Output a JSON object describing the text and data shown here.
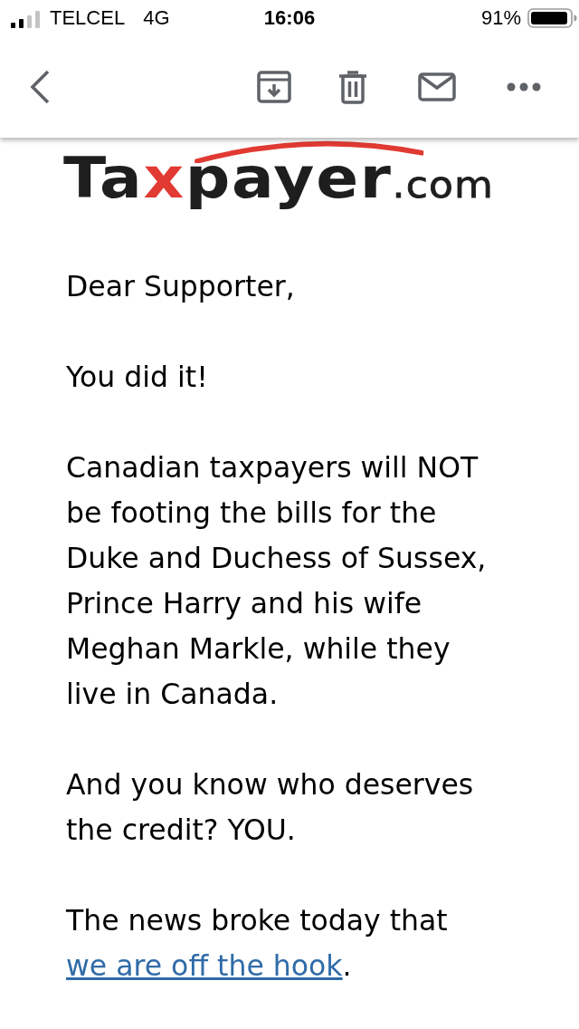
{
  "status_bar": {
    "carrier": "TELCEL",
    "network": "4G",
    "time": "16:06",
    "battery": "91%"
  },
  "logo": {
    "parts": [
      {
        "text": "Ta",
        "kind": "main"
      },
      {
        "text": "x",
        "kind": "accent"
      },
      {
        "text": "payer",
        "kind": "main"
      },
      {
        "text": ".com",
        "kind": "domain"
      }
    ]
  },
  "paragraphs": [
    {
      "text": "Dear Supporter,"
    },
    {
      "text": "You did it!"
    },
    {
      "text": "Canadian taxpayers will NOT be footing the bills for the Duke and Duchess of Sussex, Prince Harry and his wife Meghan Markle, while they live in Canada."
    },
    {
      "text": "And you know who deserves the credit? YOU."
    },
    {
      "text": "The news broke today that",
      "link": "we are off the hook",
      "tail": "."
    }
  ]
}
